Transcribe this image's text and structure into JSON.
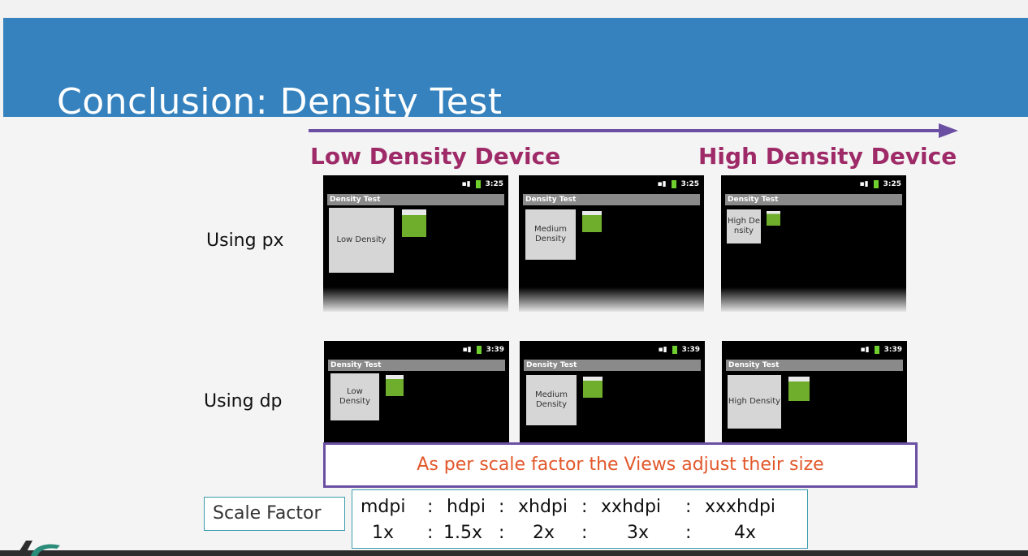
{
  "slide": {
    "title": "Conclusion: Density Test"
  },
  "density_axis": {
    "low": "Low Density Device",
    "high": "High Density Device",
    "arrow_color": "#6b4fa2",
    "label_color": "#9e2a68"
  },
  "rows": [
    {
      "label": "Using px",
      "time": "3:25",
      "screens": [
        {
          "app_title": "Density Test",
          "box_text": "Low Density"
        },
        {
          "app_title": "Density Test",
          "box_text": "Medium Density"
        },
        {
          "app_title": "Density Test",
          "box_text": "High Density"
        }
      ]
    },
    {
      "label": "Using dp",
      "time": "3:39",
      "screens": [
        {
          "app_title": "Density Test",
          "box_text": "Low Density"
        },
        {
          "app_title": "Density Test",
          "box_text": "Medium Density"
        },
        {
          "app_title": "Density Test",
          "box_text": "High Density"
        }
      ]
    }
  ],
  "callout": {
    "text": "As per scale factor the Views adjust their size",
    "text_color": "#e2572a",
    "border_color": "#6b4fa2"
  },
  "scale_factor": {
    "label": "Scale Factor",
    "densities": [
      "mdpi",
      "hdpi",
      "xhdpi",
      "xxhdpi",
      "xxxhdpi"
    ],
    "factors": [
      "1x",
      "1.5x",
      "2x",
      "3x",
      "4x"
    ],
    "separator": ":"
  },
  "colors": {
    "header": "#3582be",
    "accent": "#3a9dad"
  }
}
